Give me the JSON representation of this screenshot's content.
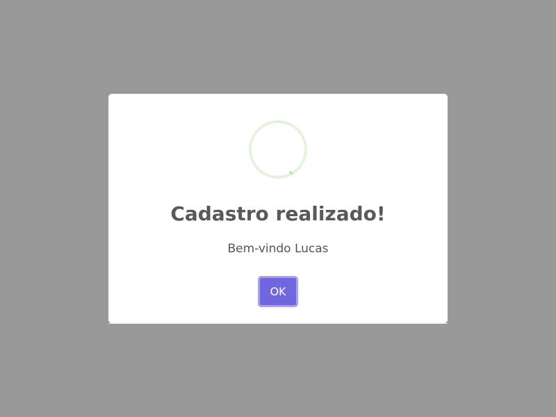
{
  "modal": {
    "icon": "success-check-icon",
    "title": "Cadastro realizado!",
    "message": "Bem-vindo Lucas",
    "confirm_label": "OK"
  },
  "colors": {
    "overlay": "#999999",
    "modal_bg": "#ffffff",
    "title": "#595959",
    "message": "#545454",
    "button_bg": "#7066e0",
    "button_border": "#a7a1ee",
    "icon_ring": "#e3f3dc",
    "icon_accent": "#a5dc86"
  }
}
